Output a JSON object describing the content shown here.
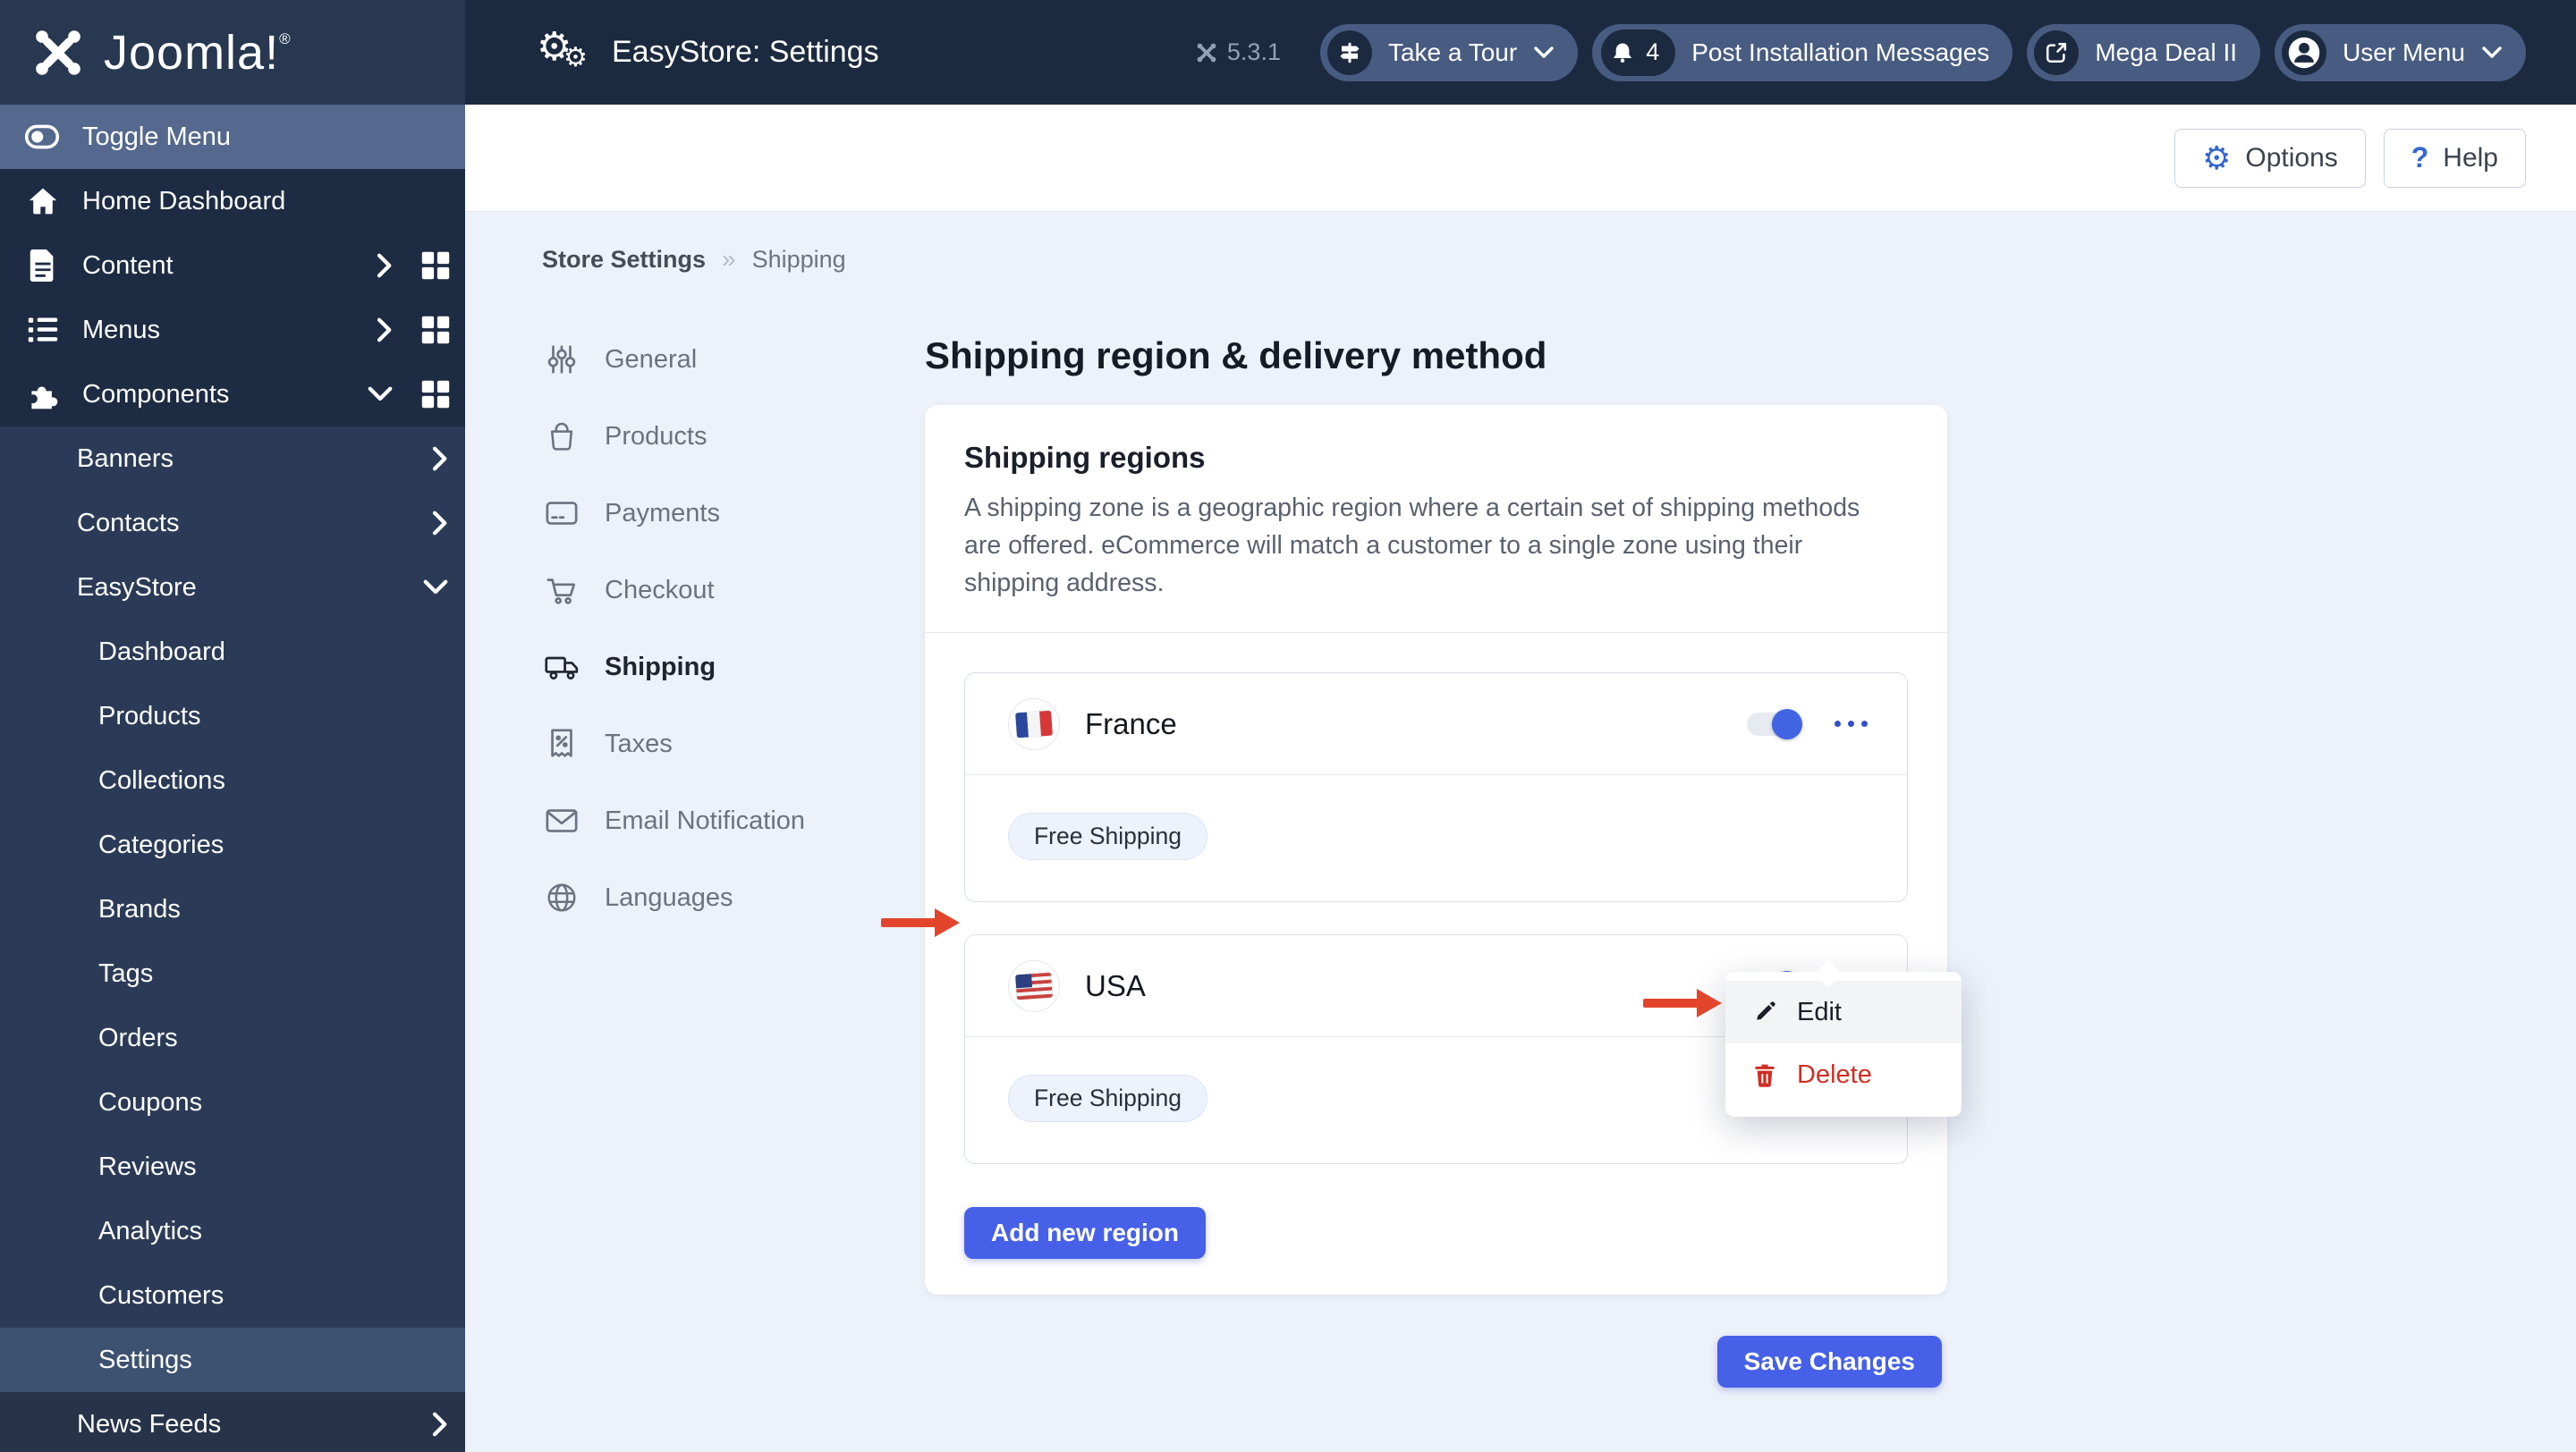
{
  "topbar": {
    "logo_text": "Joomla!",
    "logo_reg": "®",
    "title": "EasyStore: Settings",
    "version": "5.3.1",
    "pills": {
      "tour_label": "Take a Tour",
      "messages_count": "4",
      "messages_label": "Post Installation Messages",
      "mega_deal_label": "Mega Deal II",
      "user_menu_label": "User Menu"
    }
  },
  "toolbar": {
    "options_label": "Options",
    "help_label": "Help"
  },
  "sidebar": {
    "toggle_label": "Toggle Menu",
    "home_label": "Home Dashboard",
    "content_label": "Content",
    "menus_label": "Menus",
    "components_label": "Components",
    "banners_label": "Banners",
    "contacts_label": "Contacts",
    "easystore_label": "EasyStore",
    "easystore_children": [
      "Dashboard",
      "Products",
      "Collections",
      "Categories",
      "Brands",
      "Tags",
      "Orders",
      "Coupons",
      "Reviews",
      "Analytics",
      "Customers",
      "Settings"
    ],
    "news_feeds_label": "News Feeds"
  },
  "breadcrumb": {
    "root": "Store Settings",
    "separator": "»",
    "current": "Shipping"
  },
  "settings_nav": [
    {
      "label": "General"
    },
    {
      "label": "Products"
    },
    {
      "label": "Payments"
    },
    {
      "label": "Checkout"
    },
    {
      "label": "Shipping"
    },
    {
      "label": "Taxes"
    },
    {
      "label": "Email Notification"
    },
    {
      "label": "Languages"
    }
  ],
  "main": {
    "heading": "Shipping region & delivery method",
    "card": {
      "title": "Shipping regions",
      "description": "A shipping zone is a geographic region where a certain set of shipping methods are offered. eCommerce will match a customer to a single zone using their shipping address.",
      "regions": [
        {
          "name": "France",
          "country": "fr",
          "enabled": true,
          "badge": "Free Shipping"
        },
        {
          "name": "USA",
          "country": "us",
          "enabled": true,
          "badge": "Free Shipping"
        }
      ],
      "add_button_label": "Add new region"
    },
    "save_button_label": "Save Changes"
  },
  "context_menu": {
    "edit_label": "Edit",
    "delete_label": "Delete"
  },
  "colors": {
    "accent": "#4660e8",
    "toggle_on": "#4165e2",
    "danger": "#cf2e24",
    "annotation_arrow": "#e2452c",
    "sidebar_dark": "#1d2b43",
    "sidebar_submenu": "#2b3b57"
  }
}
